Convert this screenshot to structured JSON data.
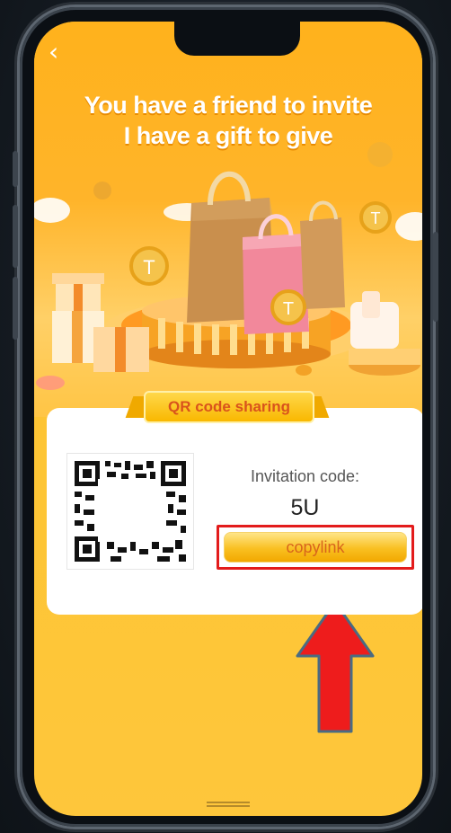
{
  "headline": {
    "line1": "You have a friend to invite",
    "line2": "I have a gift to give"
  },
  "nav": {
    "back_icon": "chevron-left-icon"
  },
  "badge": {
    "label": "QR code sharing"
  },
  "invite": {
    "label": "Invitation code:",
    "code": "5U",
    "copy_label": "copylink"
  },
  "colors": {
    "background_top": "#ffb21c",
    "background_bottom": "#fec63b",
    "button": "#f9c021",
    "button_text": "#d8641c",
    "highlight": "#e31b1b"
  }
}
